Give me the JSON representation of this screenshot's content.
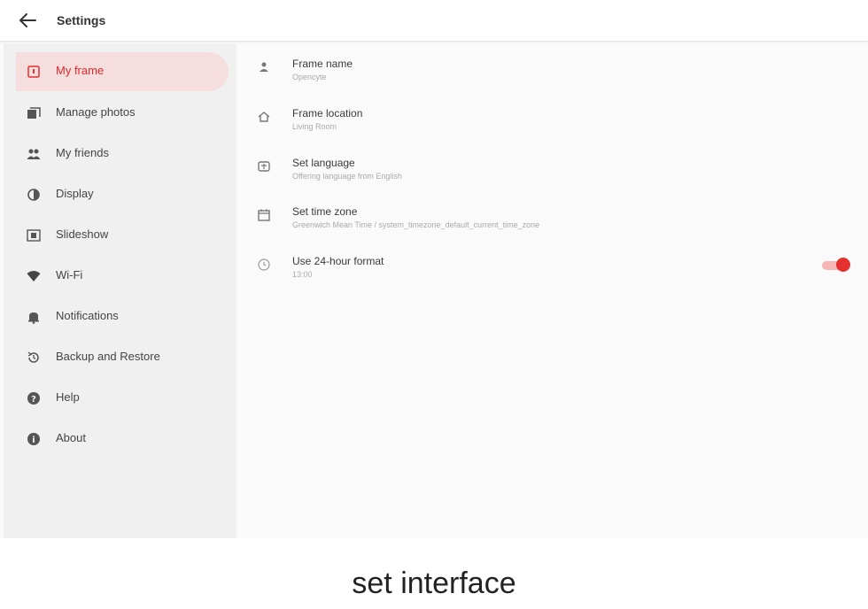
{
  "header": {
    "title": "Settings",
    "back_icon": "arrow-left-icon"
  },
  "sidebar": {
    "items": [
      {
        "label": "My frame",
        "icon": "frame-icon",
        "active": true
      },
      {
        "label": "Manage photos",
        "icon": "photos-icon",
        "active": false
      },
      {
        "label": "My friends",
        "icon": "people-icon",
        "active": false
      },
      {
        "label": "Display",
        "icon": "brightness-icon",
        "active": false
      },
      {
        "label": "Slideshow",
        "icon": "slideshow-icon",
        "active": false
      },
      {
        "label": "Wi-Fi",
        "icon": "wifi-icon",
        "active": false
      },
      {
        "label": "Notifications",
        "icon": "bell-icon",
        "active": false
      },
      {
        "label": "Backup and Restore",
        "icon": "restore-icon",
        "active": false
      },
      {
        "label": "Help",
        "icon": "help-icon",
        "active": false
      },
      {
        "label": "About",
        "icon": "info-icon",
        "active": false
      }
    ]
  },
  "settings": {
    "rows": [
      {
        "title": "Frame name",
        "subtitle": "Opencyte",
        "icon": "person-icon"
      },
      {
        "title": "Frame location",
        "subtitle": "Living Room",
        "icon": "home-icon"
      },
      {
        "title": "Set language",
        "subtitle": "Offering language from English",
        "icon": "language-icon"
      },
      {
        "title": "Set time zone",
        "subtitle": "Greenwich Mean Time / system_timezone_default_current_time_zone",
        "icon": "calendar-icon"
      },
      {
        "title": "Use 24-hour format",
        "subtitle": "13:00",
        "icon": "clock-icon",
        "toggle_on": true
      }
    ]
  },
  "caption": "set interface",
  "colors": {
    "accent": "#e53030",
    "active_bg": "#f7dede",
    "sidebar_bg": "#f0f0f0"
  }
}
